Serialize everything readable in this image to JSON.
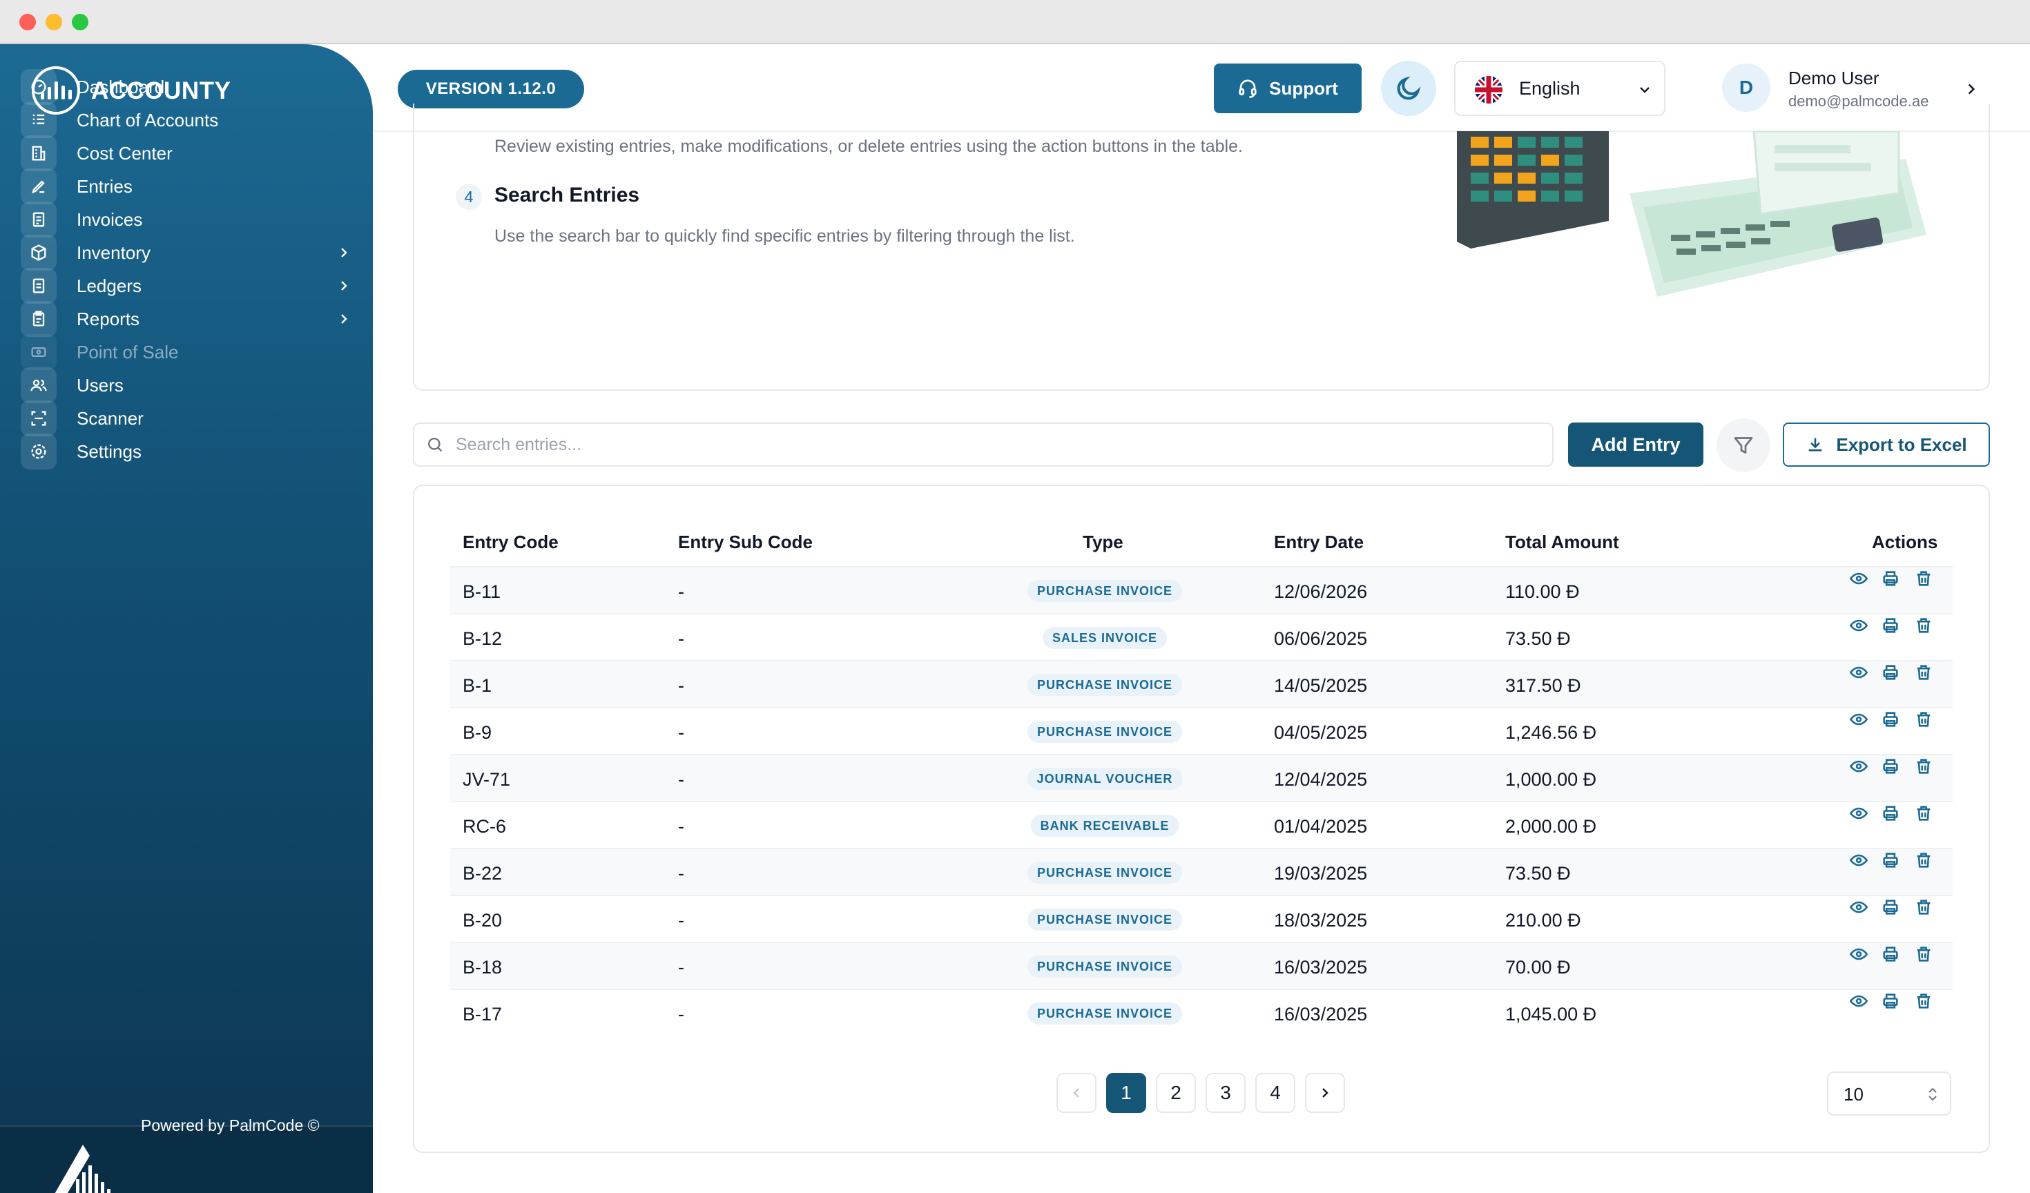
{
  "app": {
    "name": "ACCOUNTY",
    "version": "VERSION 1.12.0",
    "powered_by": "Powered by PalmCode ©"
  },
  "sidebar": {
    "items": [
      {
        "label": "Dashboard",
        "icon": "dashboard-icon",
        "chevron": false
      },
      {
        "label": "Chart of Accounts",
        "icon": "chart-of-accounts-icon",
        "chevron": false
      },
      {
        "label": "Cost Center",
        "icon": "cost-center-icon",
        "chevron": false
      },
      {
        "label": "Entries",
        "icon": "entries-icon",
        "chevron": false
      },
      {
        "label": "Invoices",
        "icon": "invoices-icon",
        "chevron": false
      },
      {
        "label": "Inventory",
        "icon": "inventory-icon",
        "chevron": true
      },
      {
        "label": "Ledgers",
        "icon": "ledgers-icon",
        "chevron": true
      },
      {
        "label": "Reports",
        "icon": "reports-icon",
        "chevron": true
      },
      {
        "label": "Point of Sale",
        "icon": "point-of-sale-icon",
        "chevron": false,
        "disabled": true
      },
      {
        "label": "Users",
        "icon": "users-icon",
        "chevron": false
      },
      {
        "label": "Scanner",
        "icon": "scanner-icon",
        "chevron": false
      },
      {
        "label": "Settings",
        "icon": "settings-icon",
        "chevron": false
      }
    ]
  },
  "header": {
    "support_label": "Support",
    "language": "English",
    "user": {
      "initial": "D",
      "name": "Demo User",
      "email": "demo@palmcode.ae"
    }
  },
  "guide": {
    "step3_desc": "Review existing entries, make modifications, or delete entries using the action buttons in the table.",
    "step4_number": "4",
    "step4_title": "Search Entries",
    "step4_desc": "Use the search bar to quickly find specific entries by filtering through the list."
  },
  "toolbar": {
    "search_placeholder": "Search entries...",
    "add_label": "Add Entry",
    "export_label": "Export to Excel"
  },
  "table": {
    "headers": [
      "Entry Code",
      "Entry Sub Code",
      "Type",
      "Entry Date",
      "Total Amount",
      "Actions"
    ],
    "currency": "Đ",
    "rows": [
      {
        "code": "B-11",
        "sub": "-",
        "type": "PURCHASE INVOICE",
        "date": "12/06/2026",
        "amount": "110.00"
      },
      {
        "code": "B-12",
        "sub": "-",
        "type": "SALES INVOICE",
        "date": "06/06/2025",
        "amount": "73.50"
      },
      {
        "code": "B-1",
        "sub": "-",
        "type": "PURCHASE INVOICE",
        "date": "14/05/2025",
        "amount": "317.50"
      },
      {
        "code": "B-9",
        "sub": "-",
        "type": "PURCHASE INVOICE",
        "date": "04/05/2025",
        "amount": "1,246.56"
      },
      {
        "code": "JV-71",
        "sub": "-",
        "type": "JOURNAL VOUCHER",
        "date": "12/04/2025",
        "amount": "1,000.00"
      },
      {
        "code": "RC-6",
        "sub": "-",
        "type": "BANK RECEIVABLE",
        "date": "01/04/2025",
        "amount": "2,000.00"
      },
      {
        "code": "B-22",
        "sub": "-",
        "type": "PURCHASE INVOICE",
        "date": "19/03/2025",
        "amount": "73.50"
      },
      {
        "code": "B-20",
        "sub": "-",
        "type": "PURCHASE INVOICE",
        "date": "18/03/2025",
        "amount": "210.00"
      },
      {
        "code": "B-18",
        "sub": "-",
        "type": "PURCHASE INVOICE",
        "date": "16/03/2025",
        "amount": "70.00"
      },
      {
        "code": "B-17",
        "sub": "-",
        "type": "PURCHASE INVOICE",
        "date": "16/03/2025",
        "amount": "1,045.00"
      }
    ]
  },
  "pagination": {
    "pages": [
      "1",
      "2",
      "3",
      "4"
    ],
    "current": "1",
    "page_size": "10"
  },
  "colors": {
    "primary": "#1a6a94",
    "primary_dark": "#155576",
    "badge_bg": "#e9f2f8"
  }
}
